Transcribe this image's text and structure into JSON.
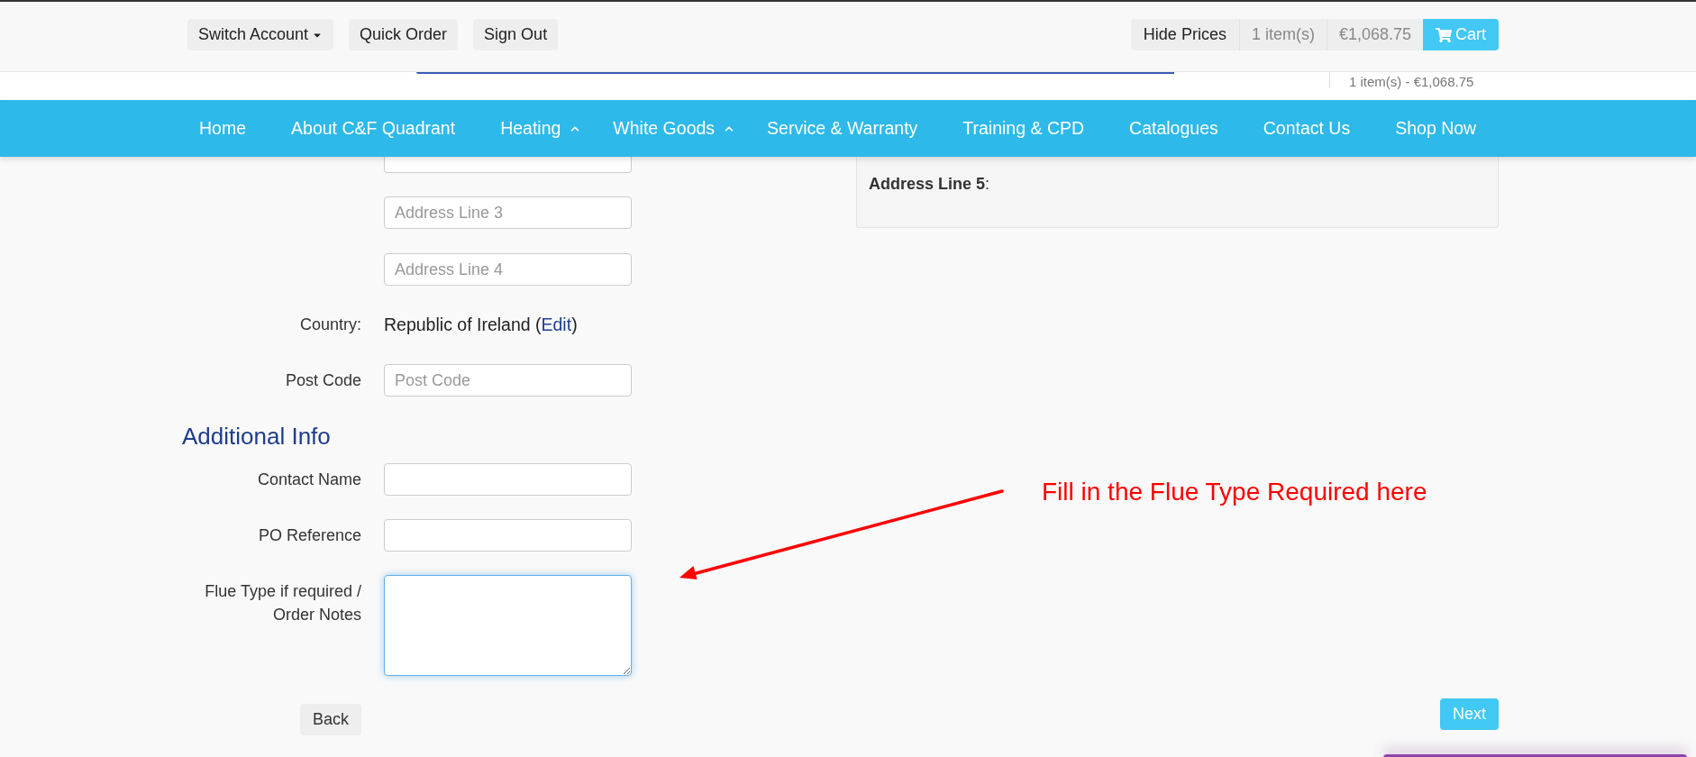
{
  "top_bar": {
    "buttons": [
      {
        "label": "Switch Account",
        "kind": "dropdown"
      },
      {
        "label": "Quick Order",
        "kind": "plain"
      },
      {
        "label": "Sign Out",
        "kind": "plain"
      }
    ],
    "cart_group": {
      "hide_prices": "Hide Prices",
      "item_count": "1 item(s)",
      "total": "€1,068.75",
      "cart": "Cart"
    }
  },
  "header_strip": {
    "cart_summary": "1 item(s) - €1,068.75"
  },
  "nav": {
    "items": [
      {
        "label": "Home",
        "dropdown": false
      },
      {
        "label": "About C&F Quadrant",
        "dropdown": false
      },
      {
        "label": "Heating",
        "dropdown": true
      },
      {
        "label": "White Goods",
        "dropdown": true
      },
      {
        "label": "Service & Warranty",
        "dropdown": false
      },
      {
        "label": "Training & CPD",
        "dropdown": false
      },
      {
        "label": "Catalogues",
        "dropdown": false
      },
      {
        "label": "Contact Us",
        "dropdown": false
      },
      {
        "label": "Shop Now",
        "dropdown": false
      }
    ]
  },
  "form": {
    "rows": [
      {
        "kind": "cut-input"
      },
      {
        "kind": "input",
        "placeholder": "Address Line 3"
      },
      {
        "kind": "input",
        "placeholder": "Address Line 4"
      },
      {
        "kind": "text",
        "label": "Country:",
        "value": "Republic of Ireland (",
        "link": "Edit",
        "suffix": ")"
      },
      {
        "kind": "input",
        "label": "Post Code",
        "placeholder": "Post Code"
      },
      {
        "kind": "heading",
        "text": "Additional Info"
      },
      {
        "kind": "input",
        "label": "Contact Name"
      },
      {
        "kind": "input",
        "label": "PO Reference"
      },
      {
        "kind": "textarea",
        "label": "Flue Type if required / Order Notes",
        "focused": true
      }
    ],
    "back_button": "Back"
  },
  "address_panel": {
    "text": "**Address Line 5**:"
  },
  "next_button": "Next",
  "annotation": {
    "text": "Fill in the Flue Type Required here"
  }
}
